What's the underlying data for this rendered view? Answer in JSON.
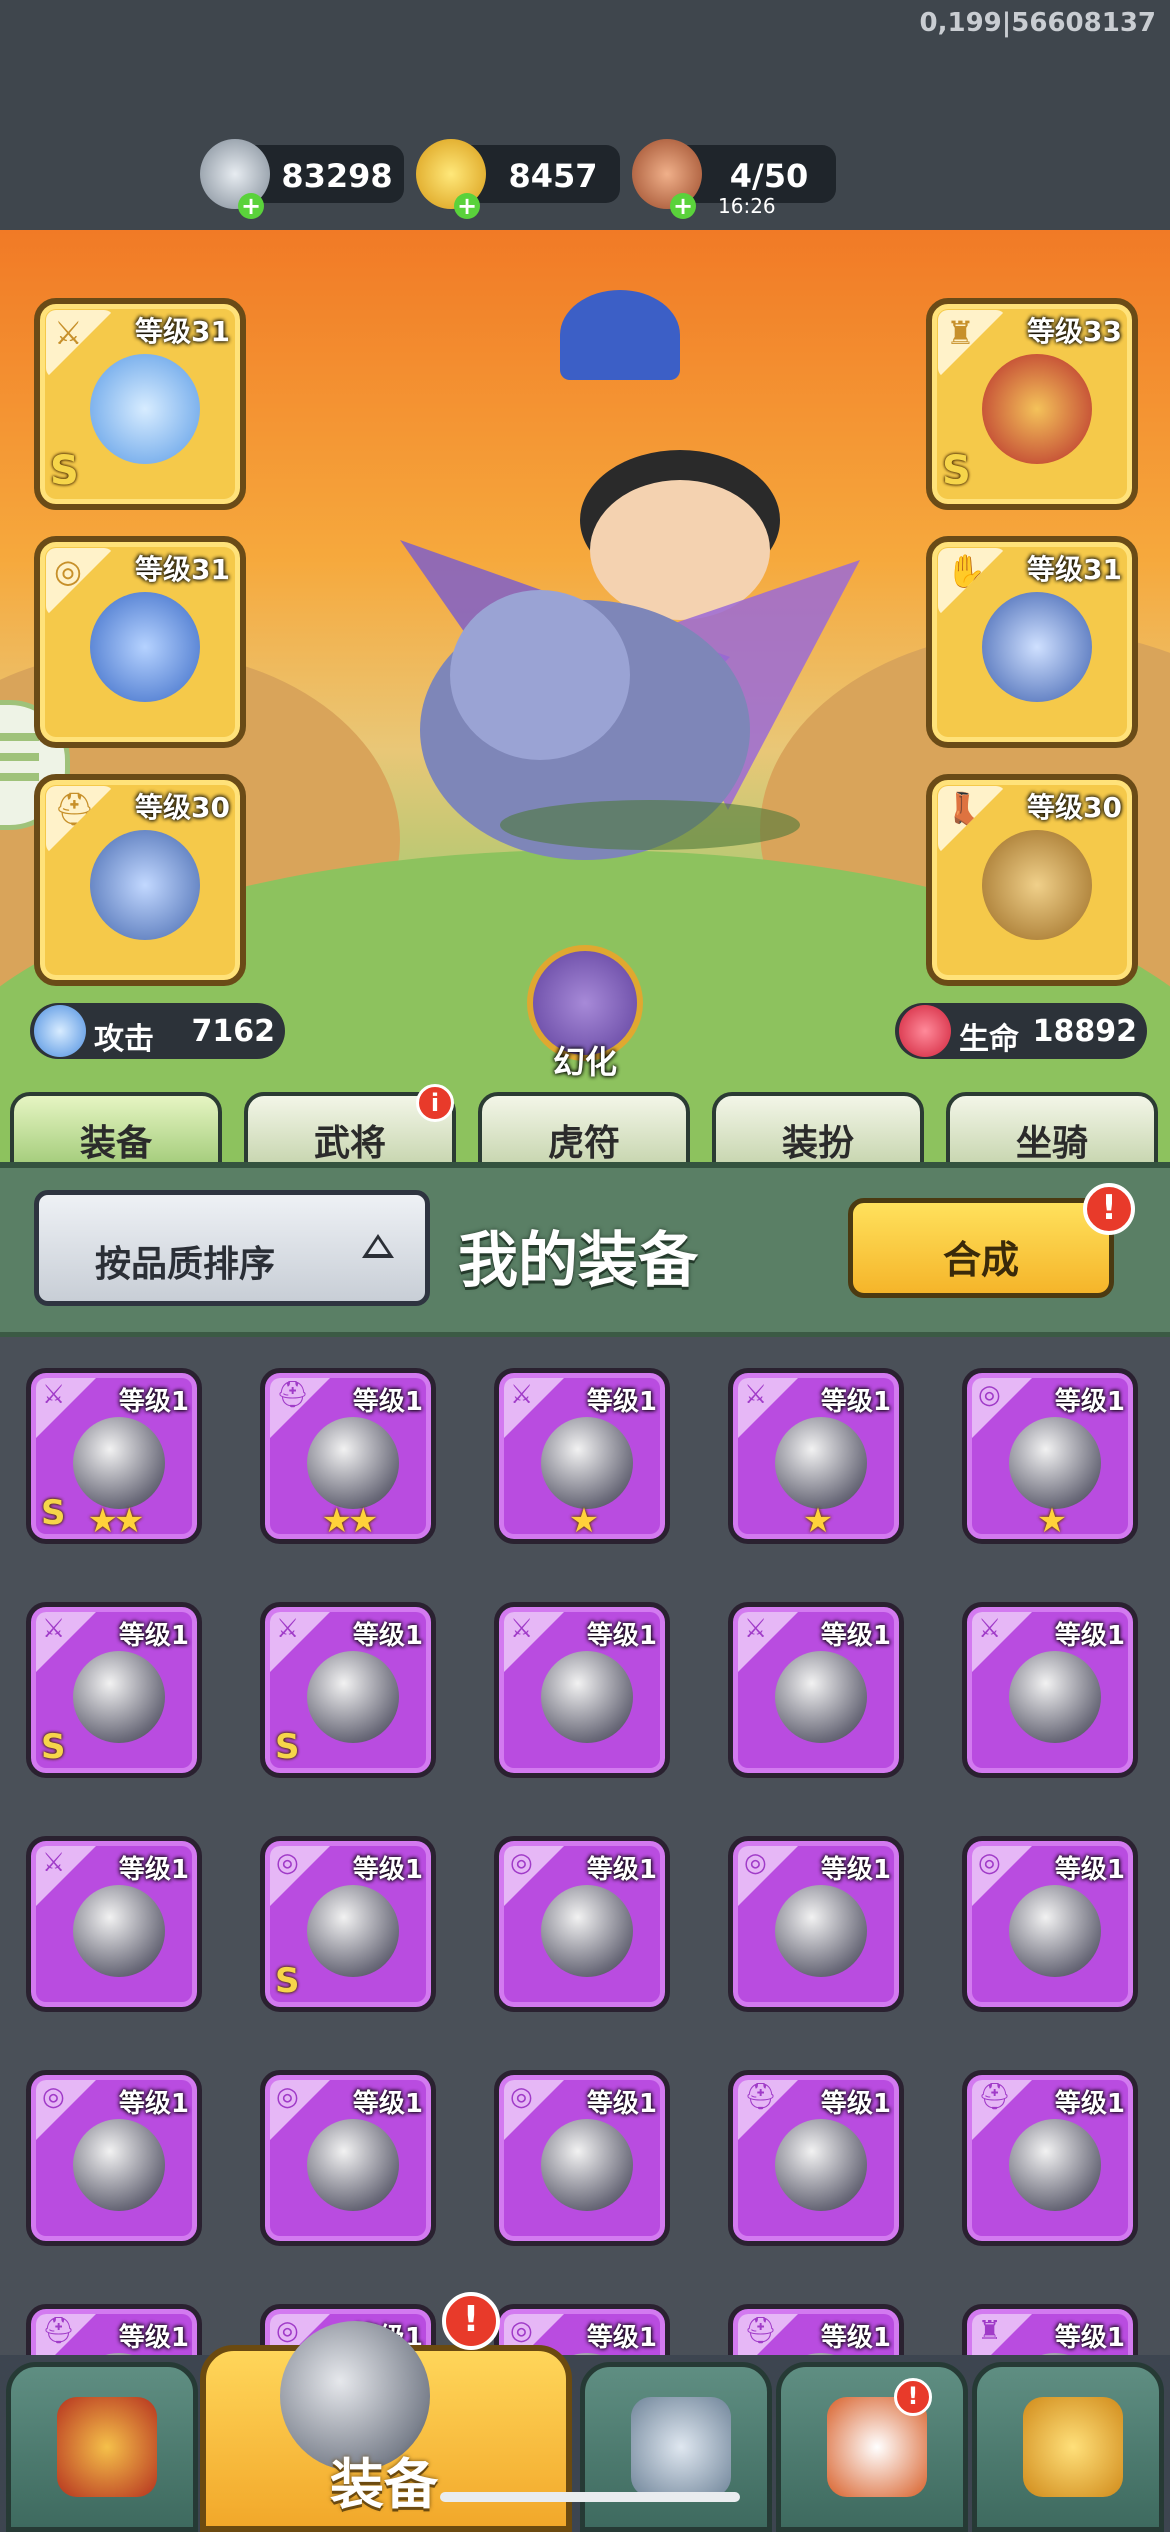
{
  "build_info": "0,199|56608137",
  "resources": [
    {
      "name": "silver",
      "value": "83298",
      "color": "#b9c2cc"
    },
    {
      "name": "gold-ingot",
      "value": "8457",
      "color": "#f5c431"
    },
    {
      "name": "meat-energy",
      "value": "4/50",
      "timer": "16:26",
      "color": "#d98a5a"
    }
  ],
  "equipped_left": [
    {
      "slot": "weapon",
      "icon": "sword-icon",
      "level": "等级31",
      "grade": "S",
      "color": "#6fb6ff"
    },
    {
      "slot": "amulet",
      "icon": "medal-icon",
      "level": "等级31",
      "grade": "",
      "color": "#4f7cc8"
    },
    {
      "slot": "helmet",
      "icon": "helmet-icon",
      "level": "等级30",
      "grade": "",
      "color": "#5d86c5"
    }
  ],
  "equipped_right": [
    {
      "slot": "armor",
      "icon": "armor-icon",
      "level": "等级33",
      "grade": "S",
      "color": "#c8332e"
    },
    {
      "slot": "bracer",
      "icon": "bracer-icon",
      "level": "等级31",
      "grade": "",
      "color": "#4f7cc8"
    },
    {
      "slot": "boots",
      "icon": "boot-icon",
      "level": "等级30",
      "grade": "",
      "color": "#b58a3a"
    }
  ],
  "stats": {
    "attack_label": "攻击",
    "attack_value": "7162",
    "hp_label": "生命",
    "hp_value": "18892"
  },
  "transform_label": "幻化",
  "tabs": [
    {
      "label": "装备",
      "active": true,
      "alert": false
    },
    {
      "label": "武将",
      "active": false,
      "alert": true
    },
    {
      "label": "虎符",
      "active": false,
      "alert": false
    },
    {
      "label": "装扮",
      "active": false,
      "alert": false
    },
    {
      "label": "坐骑",
      "active": false,
      "alert": false
    }
  ],
  "panel": {
    "sort_label": "按品质排序",
    "title": "我的装备",
    "merge_label": "合成",
    "alert_mark": "!"
  },
  "inventory": [
    {
      "icon": "sword-icon",
      "level": "等级1",
      "grade": "S",
      "stars": 2
    },
    {
      "icon": "helmet-icon",
      "level": "等级1",
      "grade": "",
      "stars": 2
    },
    {
      "icon": "sword-icon",
      "level": "等级1",
      "grade": "",
      "stars": 1
    },
    {
      "icon": "sword-icon",
      "level": "等级1",
      "grade": "",
      "stars": 1
    },
    {
      "icon": "medal-icon",
      "level": "等级1",
      "grade": "",
      "stars": 1
    },
    {
      "icon": "sword-icon",
      "level": "等级1",
      "grade": "S",
      "stars": 0
    },
    {
      "icon": "sword-icon",
      "level": "等级1",
      "grade": "S",
      "stars": 0
    },
    {
      "icon": "sword-icon",
      "level": "等级1",
      "grade": "",
      "stars": 0
    },
    {
      "icon": "sword-icon",
      "level": "等级1",
      "grade": "",
      "stars": 0
    },
    {
      "icon": "sword-icon",
      "level": "等级1",
      "grade": "",
      "stars": 0
    },
    {
      "icon": "sword-icon",
      "level": "等级1",
      "grade": "",
      "stars": 0
    },
    {
      "icon": "medal-icon",
      "level": "等级1",
      "grade": "S",
      "stars": 0
    },
    {
      "icon": "medal-icon",
      "level": "等级1",
      "grade": "",
      "stars": 0
    },
    {
      "icon": "medal-icon",
      "level": "等级1",
      "grade": "",
      "stars": 0
    },
    {
      "icon": "medal-icon",
      "level": "等级1",
      "grade": "",
      "stars": 0
    },
    {
      "icon": "medal-icon",
      "level": "等级1",
      "grade": "",
      "stars": 0
    },
    {
      "icon": "medal-icon",
      "level": "等级1",
      "grade": "",
      "stars": 0
    },
    {
      "icon": "medal-icon",
      "level": "等级1",
      "grade": "",
      "stars": 0
    },
    {
      "icon": "helmet-icon",
      "level": "等级1",
      "grade": "",
      "stars": 0
    },
    {
      "icon": "helmet-icon",
      "level": "等级1",
      "grade": "",
      "stars": 0
    },
    {
      "icon": "helmet-icon",
      "level": "等级1",
      "grade": "",
      "stars": 0
    },
    {
      "icon": "medal-icon",
      "level": "等级1",
      "grade": "",
      "stars": 0
    },
    {
      "icon": "medal-icon",
      "level": "等级1",
      "grade": "",
      "stars": 0
    },
    {
      "icon": "helmet-icon",
      "level": "等级1",
      "grade": "",
      "stars": 0
    },
    {
      "icon": "armor-icon",
      "level": "等级1",
      "grade": "",
      "stars": 0
    }
  ],
  "bottom_nav": [
    {
      "name": "gate-icon",
      "label": ""
    },
    {
      "name": "equipment-helmet-icon",
      "label": "装备",
      "alert": true
    },
    {
      "name": "crossed-swords-shield-icon",
      "label": ""
    },
    {
      "name": "pet-bird-icon",
      "label": "",
      "alert": true
    },
    {
      "name": "upgrade-fist-icon",
      "label": ""
    }
  ]
}
